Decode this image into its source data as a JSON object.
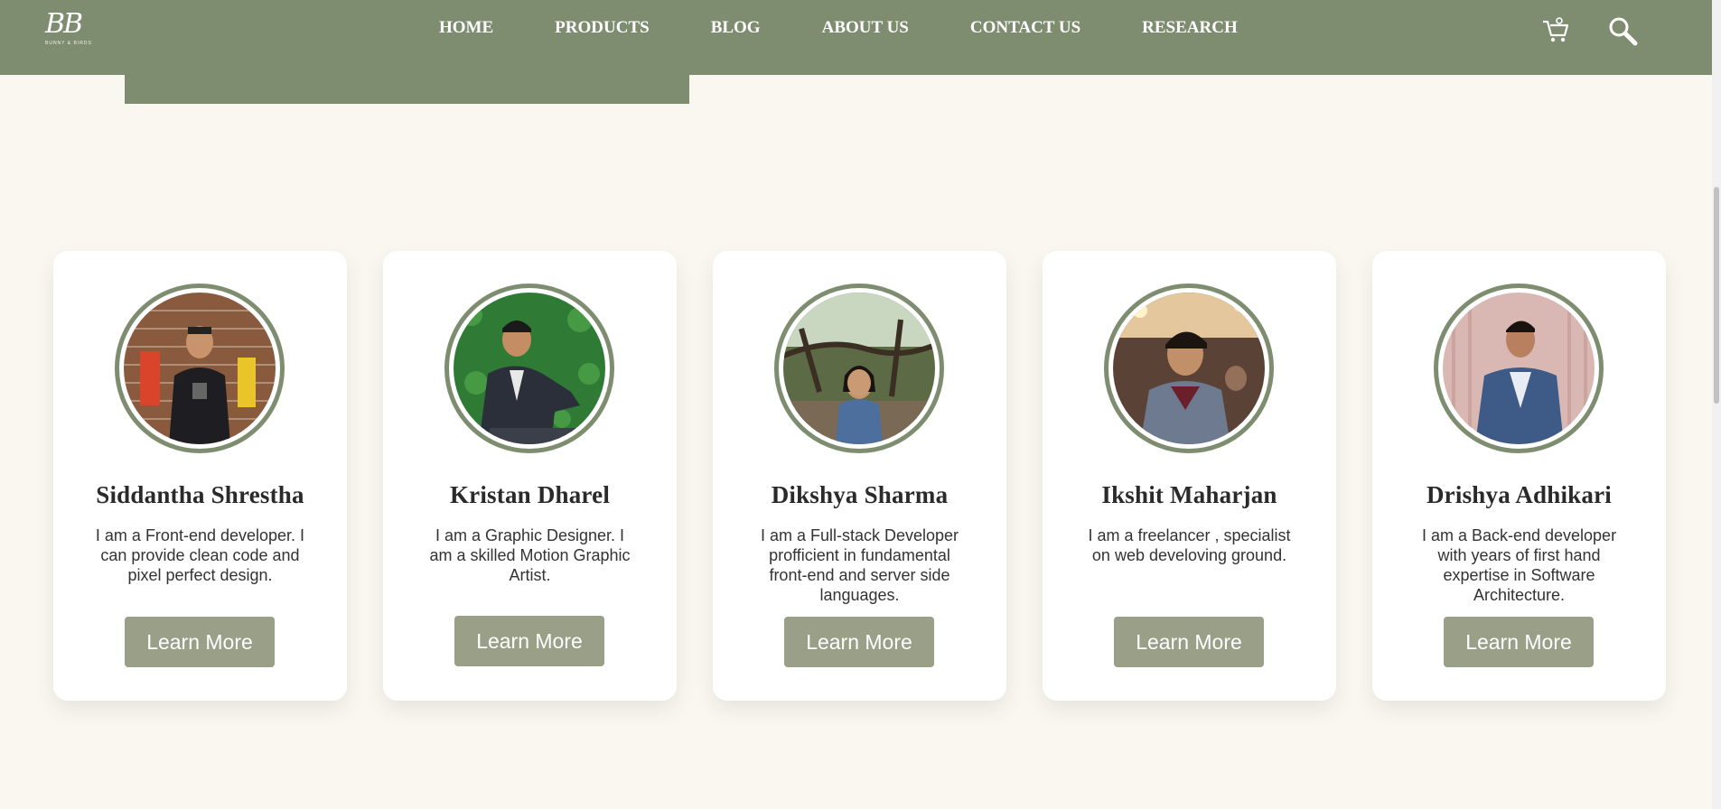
{
  "header": {
    "logo_text": "BB",
    "logo_sub": "BUNNY & BIRDS",
    "nav": [
      "HOME",
      "PRODUCTS",
      "BLOG",
      "ABOUT US",
      "CONTACT US",
      "RESEARCH"
    ],
    "icons": [
      "cart-icon",
      "search-icon"
    ]
  },
  "colors": {
    "brand": "#7e8d6f",
    "button": "#9a9f88",
    "page": "#faf7f1"
  },
  "team": [
    {
      "name": "Siddantha Shrestha",
      "desc": "I am a Front-end developer. I can provide clean code and pixel perfect design.",
      "button": "Learn More"
    },
    {
      "name": "Kristan Dharel",
      "desc": "I am a Graphic Designer. I am a skilled Motion Graphic Artist.",
      "button": "Learn More"
    },
    {
      "name": "Dikshya Sharma",
      "desc": "I am a Full-stack Developer profficient in fundamental front-end and server side languages.",
      "button": "Learn More"
    },
    {
      "name": "Ikshit Maharjan",
      "desc": "I am a freelancer , specialist on web develoving ground.",
      "button": "Learn More"
    },
    {
      "name": "Drishya Adhikari",
      "desc": "I am a Back-end developer with years of first hand expertise in Software Architecture.",
      "button": "Learn More"
    }
  ]
}
